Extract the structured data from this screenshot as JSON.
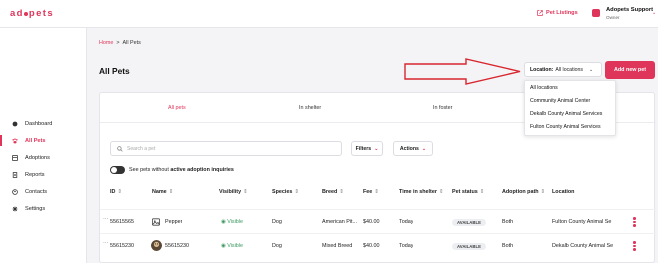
{
  "app": {
    "logo_text": "adopets",
    "pet_listings": "Pet Listings",
    "user_name": "Adopets Support",
    "user_role": "Owner",
    "accent": "#e0355a"
  },
  "sidebar": {
    "items": [
      {
        "label": "Dashboard",
        "icon": "dashboard-icon"
      },
      {
        "label": "All Pets",
        "icon": "paw-icon"
      },
      {
        "label": "Adoptions",
        "icon": "adoptions-icon"
      },
      {
        "label": "Reports",
        "icon": "reports-icon"
      },
      {
        "label": "Contacts",
        "icon": "contacts-icon"
      },
      {
        "label": "Settings",
        "icon": "settings-icon"
      }
    ]
  },
  "breadcrumb": {
    "home": "Home",
    "separator": ">",
    "current": "All Pets"
  },
  "page": {
    "title": "All Pets",
    "add_button": "Add new pet"
  },
  "location": {
    "label": "Location:",
    "value": "All locations",
    "options": [
      "All locations",
      "Community Animal Center",
      "Dekalb County Animal Services",
      "Fulton County Animal Services"
    ]
  },
  "tabs": [
    "All pets",
    "In shelter",
    "In foster"
  ],
  "search": {
    "placeholder": "Search a pet"
  },
  "filters_label": "Filters",
  "actions_label": "Actions",
  "toggle": {
    "text": "See pets without",
    "bold": "active adoption inquiries"
  },
  "table": {
    "columns": [
      "ID",
      "Name",
      "Visibility",
      "Species",
      "Breed",
      "Fee",
      "Time in shelter",
      "Pet status",
      "Adoption path",
      "Location"
    ],
    "rows": [
      {
        "id": "55615565",
        "name": "Pepper",
        "visibility": "Visible",
        "species": "Dog",
        "breed": "American Pit...",
        "fee": "$40.00",
        "time": "Today",
        "status": "AVAILABLE",
        "path": "Both",
        "location": "Fulton County Animal Se"
      },
      {
        "id": "55615230",
        "name": "55615230",
        "visibility": "Visible",
        "species": "Dog",
        "breed": "Mixed Breed",
        "fee": "$40.00",
        "time": "Today",
        "status": "AVAILABLE",
        "path": "Both",
        "location": "Dekalb County Animal Se"
      }
    ]
  }
}
